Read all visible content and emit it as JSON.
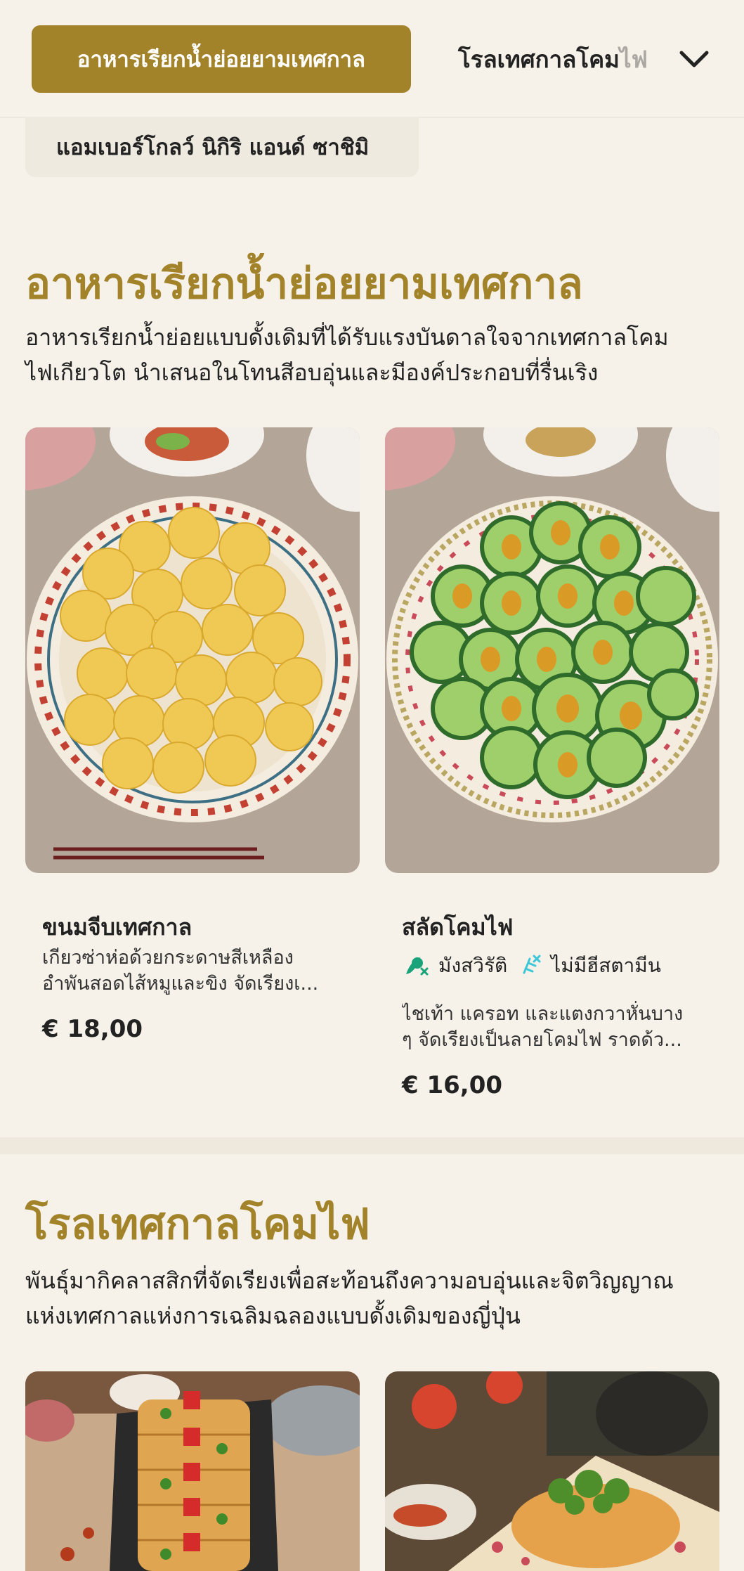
{
  "categories": {
    "active": "อาหารเรียกน้ำย่อยยามเทศกาล",
    "next_visible": "โรลเทศกาลโคม",
    "next_faded": "ไฟ"
  },
  "subcategory": "แอมเบอร์โกลว์ นิกิริ แอนด์ ซาชิมิ",
  "sections": [
    {
      "title": "อาหารเรียกน้ำย่อยยามเทศกาล",
      "description_line1": "อาหารเรียกน้ำย่อยแบบดั้งเดิมที่ได้รับแรงบันดาลใจจากเทศกาลโคม",
      "description_line2": "ไฟเกียวโต นำเสนอในโทนสีอบอุ่นและมีองค์ประกอบที่รื่นเริง",
      "items": [
        {
          "name": "ขนมจีบเทศกาล",
          "desc_line1": "เกียวซ่าห่อด้วยกระดาษสีเหลือง",
          "desc_line2": "อำพันสอดไส้หมูและขิง จัดเรียงเ...",
          "price": "€ 18,00"
        },
        {
          "name": "สลัดโคมไฟ",
          "tags": [
            "มังสวิรัติ",
            "ไม่มีฮีสตามีน"
          ],
          "desc_line1": "ไชเท้า แครอท และแตงกวาหั่นบาง",
          "desc_line2": "ๆ จัดเรียงเป็นลายโคมไฟ ราดด้ว...",
          "price": "€ 16,00"
        }
      ]
    },
    {
      "title": "โรลเทศกาลโคมไฟ",
      "description_line1": "พันธุ์มากิคลาสสิกที่จัดเรียงเพื่อสะท้อนถึงความอบอุ่นและจิตวิญญาณ",
      "description_line2": "แห่งเทศกาลแห่งการเฉลิมฉลองแบบดั้งเดิมของญี่ปุ่น"
    }
  ],
  "colors": {
    "accent": "#a2832a",
    "background": "#f6f2ea",
    "vegetarian": "#1aa37a",
    "histamine": "#3cc6d8"
  }
}
